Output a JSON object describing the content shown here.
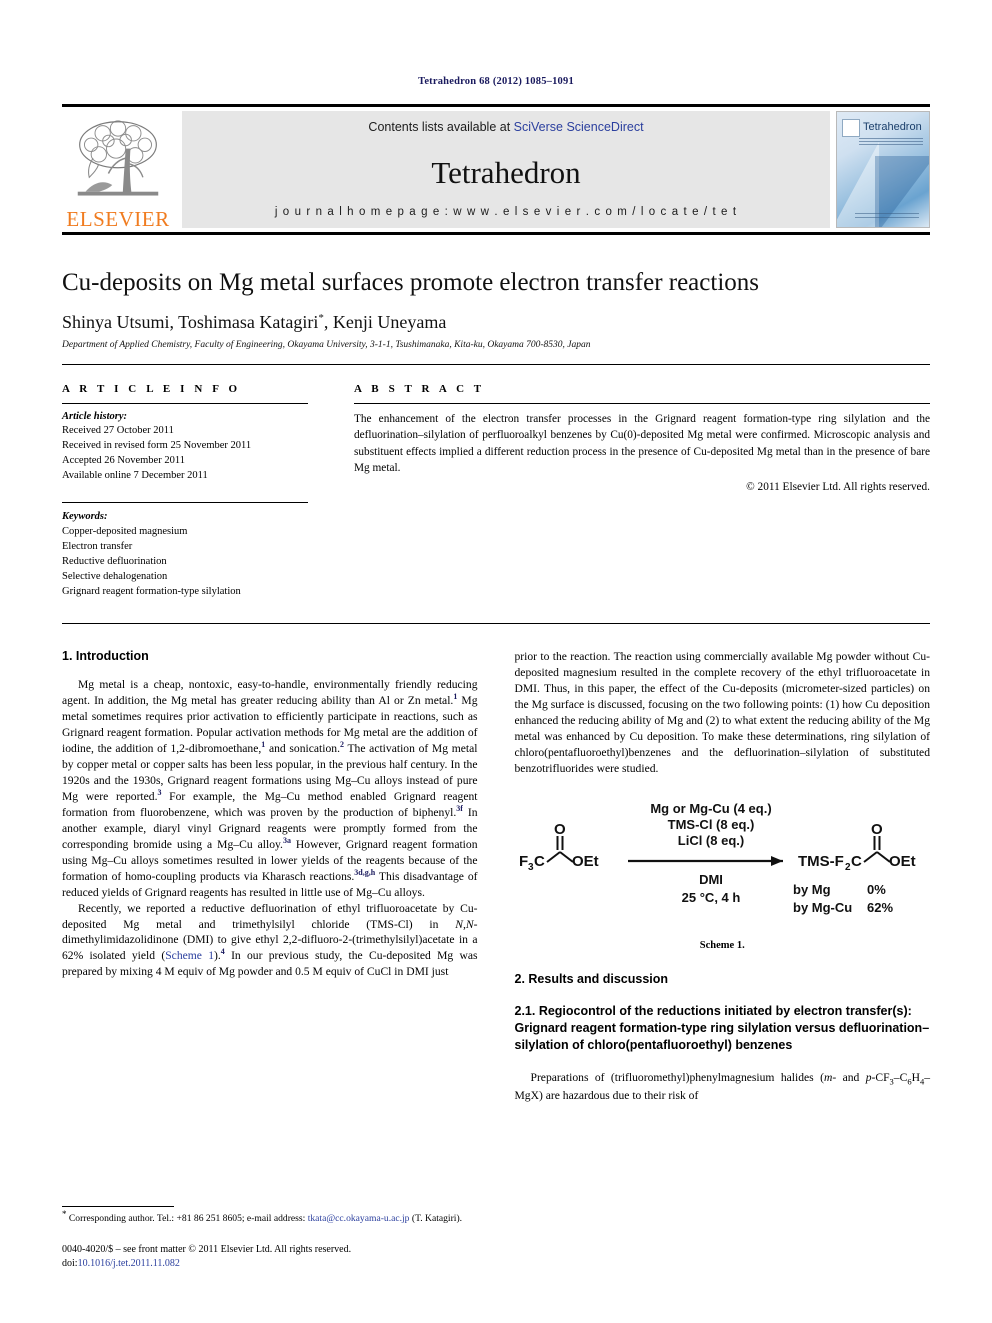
{
  "running_head": "Tetrahedron 68 (2012) 1085–1091",
  "masthead": {
    "publisher_name": "ELSEVIER",
    "contents_prefix": "Contents lists available at ",
    "contents_link": "SciVerse ScienceDirect",
    "journal_title": "Tetrahedron",
    "homepage": "j o u r n a l   h o m e p a g e :   w w w . e l s e v i e r . c o m / l o c a t e / t e t",
    "cover_title": "Tetrahedron",
    "link_color": "#2b3f9e"
  },
  "title_block": {
    "title": "Cu-deposits on Mg metal surfaces promote electron transfer reactions",
    "authors": "Shinya Utsumi, Toshimasa Katagiri",
    "authors_tail": ", Kenji Uneyama",
    "corresponding_marker": "*",
    "affiliation": "Department of Applied Chemistry, Faculty of Engineering, Okayama University, 3-1-1, Tsushimanaka, Kita-ku, Okayama 700-8530, Japan"
  },
  "article_info": {
    "heading": "A R T I C L E   I N F O",
    "history_label": "Article history:",
    "history": [
      "Received 27 October 2011",
      "Received in revised form 25 November 2011",
      "Accepted 26 November 2011",
      "Available online 7 December 2011"
    ],
    "keywords_label": "Keywords:",
    "keywords": [
      "Copper-deposited magnesium",
      "Electron transfer",
      "Reductive defluorination",
      "Selective dehalogenation",
      "Grignard reagent formation-type silylation"
    ]
  },
  "abstract": {
    "heading": "A B S T R A C T",
    "text": "The enhancement of the electron transfer processes in the Grignard reagent formation-type ring silylation and the defluorination–silylation of perfluoroalkyl benzenes by Cu(0)-deposited Mg metal were confirmed. Microscopic analysis and substituent effects implied a different reduction process in the presence of Cu-deposited Mg metal than in the presence of bare Mg metal.",
    "copyright": "© 2011 Elsevier Ltd. All rights reserved."
  },
  "body": {
    "intro_heading": "1. Introduction",
    "intro_p1_a": "Mg metal is a cheap, nontoxic, easy-to-handle, environmentally friendly reducing agent. In addition, the Mg metal has greater reducing ability than Al or Zn metal.",
    "intro_p1_b": " Mg metal sometimes requires prior activation to efficiently participate in reactions, such as Grignard reagent formation. Popular activation methods for Mg metal are the addition of iodine, the addition of 1,2-dibromoethane,",
    "intro_p1_c": " and sonication.",
    "intro_p1_d": " The activation of Mg metal by copper metal or copper salts has been less popular, in the previous half century. In the 1920s and the 1930s, Grignard reagent formations using Mg–Cu alloys instead of pure Mg were reported.",
    "intro_p1_e": " For example, the Mg–Cu method enabled Grignard reagent formation from fluorobenzene, which was proven by the production of biphenyl.",
    "intro_p1_f": " In another example, diaryl vinyl Grignard reagents were promptly formed from the corresponding bromide using a Mg–Cu alloy.",
    "intro_p1_g": " However, Grignard reagent formation using Mg–Cu alloys sometimes resulted in lower yields of the reagents because of the formation of homo-coupling products via Kharasch reactions.",
    "intro_p1_h": " This disadvantage of reduced yields of Grignard reagents has resulted in little use of Mg–Cu alloys.",
    "ref1": "1",
    "ref2": "2",
    "ref3": "3",
    "ref3f": "3f",
    "ref3a": "3a",
    "ref3dgh": "3d,g,h",
    "ref4": "4",
    "intro_p2_a": "Recently, we reported a reductive defluorination of ethyl trifluoroacetate by Cu-deposited Mg metal and trimethylsilyl chloride (TMS-Cl) in ",
    "intro_p2_ital": "N,N",
    "intro_p2_b": "-dimethylimidazolidinone (DMI) to give ethyl 2,2-difluoro-2-(trimethylsilyl)acetate in a 62% isolated yield (",
    "intro_p2_link": "Scheme 1",
    "intro_p2_c": ").",
    "intro_p2_d": " In our previous study, the Cu-deposited Mg was prepared by mixing 4 M equiv of Mg powder and 0.5 M equiv of CuCl in DMI just",
    "right_p1": "prior to the reaction. The reaction using commercially available Mg powder without Cu-deposited magnesium resulted in the complete recovery of the ethyl trifluoroacetate in DMI. Thus, in this paper, the effect of the Cu-deposits (micrometer-sized particles) on the Mg surface is discussed, focusing on the two following points: (1) how Cu deposition enhanced the reducing ability of Mg and (2) to what extent the reducing ability of the Mg metal was enhanced by Cu deposition. To make these determinations, ring silylation of chloro(pentafluoroethyl)benzenes and the defluorination–silylation of substituted benzotrifluorides were studied.",
    "results_heading": "2. Results and discussion",
    "subsec_heading": "2.1. Regiocontrol of the reductions initiated by electron transfer(s): Grignard reagent formation-type ring silylation versus defluorination–silylation of chloro(pentafluoroethyl) benzenes",
    "right_p2_a": "Preparations of (trifluoromethyl)phenylmagnesium halides (",
    "right_p2_ital1": "m",
    "right_p2_b": "- and ",
    "right_p2_ital2": "p",
    "right_p2_c": "-CF",
    "right_p2_sub1": "3",
    "right_p2_d": "–C",
    "right_p2_sub2": "6",
    "right_p2_e": "H",
    "right_p2_sub3": "4",
    "right_p2_f": "–MgX) are hazardous due to their risk of"
  },
  "scheme": {
    "caption": "Scheme 1.",
    "reagent_line1": "Mg or Mg-Cu (4 eq.)",
    "reagent_line2": "TMS-Cl (8 eq.)",
    "reagent_line3": "LiCl (8 eq.)",
    "solvent_line1": "DMI",
    "solvent_line2": "25 °C, 4 h",
    "substrate_f": "F",
    "substrate_f_sub": "3",
    "substrate_c": "C",
    "substrate_oet": "OEt",
    "product_tms": "TMS-F",
    "product_tms_sub": "2",
    "product_c": "C",
    "product_oet": "OEt",
    "yield_row1_label": "by Mg",
    "yield_row1_value": "0%",
    "yield_row2_label": "by Mg-Cu",
    "yield_row2_value": "62%"
  },
  "footer": {
    "corr_star": "*",
    "corr_text_a": " Corresponding author. Tel.: +81 86 251 8605; e-mail address: ",
    "corr_email": "tkata@cc.okayama-u.ac.jp",
    "corr_text_b": " (T. Katagiri).",
    "issn_line": "0040-4020/$ – see front matter © 2011 Elsevier Ltd. All rights reserved.",
    "doi_label": "doi:",
    "doi_value": "10.1016/j.tet.2011.11.082"
  }
}
